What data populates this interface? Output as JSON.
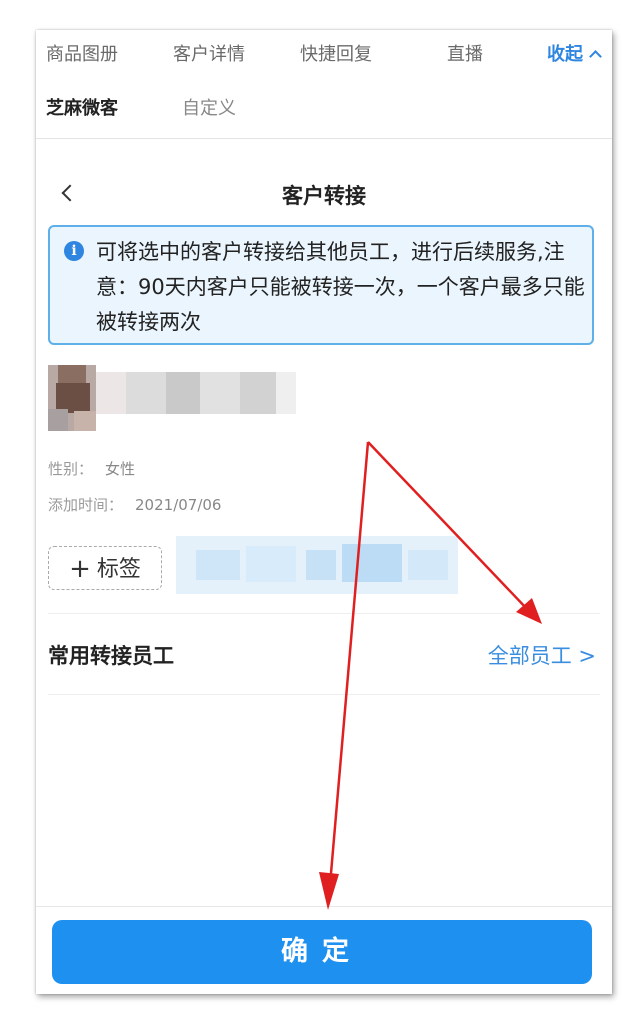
{
  "top_tabs": {
    "items": [
      {
        "label": "商品图册"
      },
      {
        "label": "客户详情"
      },
      {
        "label": "快捷回复"
      },
      {
        "label": "直播"
      }
    ],
    "collapse_label": "收起"
  },
  "sub_tabs": {
    "items": [
      {
        "label": "芝麻微客"
      },
      {
        "label": "自定义"
      }
    ]
  },
  "header": {
    "title": "客户转接"
  },
  "notice": {
    "icon": "info-icon",
    "text": "可将选中的客户转接给其他员工，进行后续服务,注意：90天内客户只能被转接一次，一个客户最多只能被转接两次"
  },
  "customer": {
    "gender_label": "性别：",
    "gender_value": "女性",
    "added_label": "添加时间：",
    "added_value": "2021/07/06",
    "add_tag_label": "标签"
  },
  "transfer": {
    "section_title": "常用转接员工",
    "all_staff_label": "全部员工 >"
  },
  "footer": {
    "confirm_label": "确定"
  },
  "colors": {
    "accent": "#2f86e0",
    "button": "#1e90f0",
    "annotation_arrow": "#e02020"
  }
}
